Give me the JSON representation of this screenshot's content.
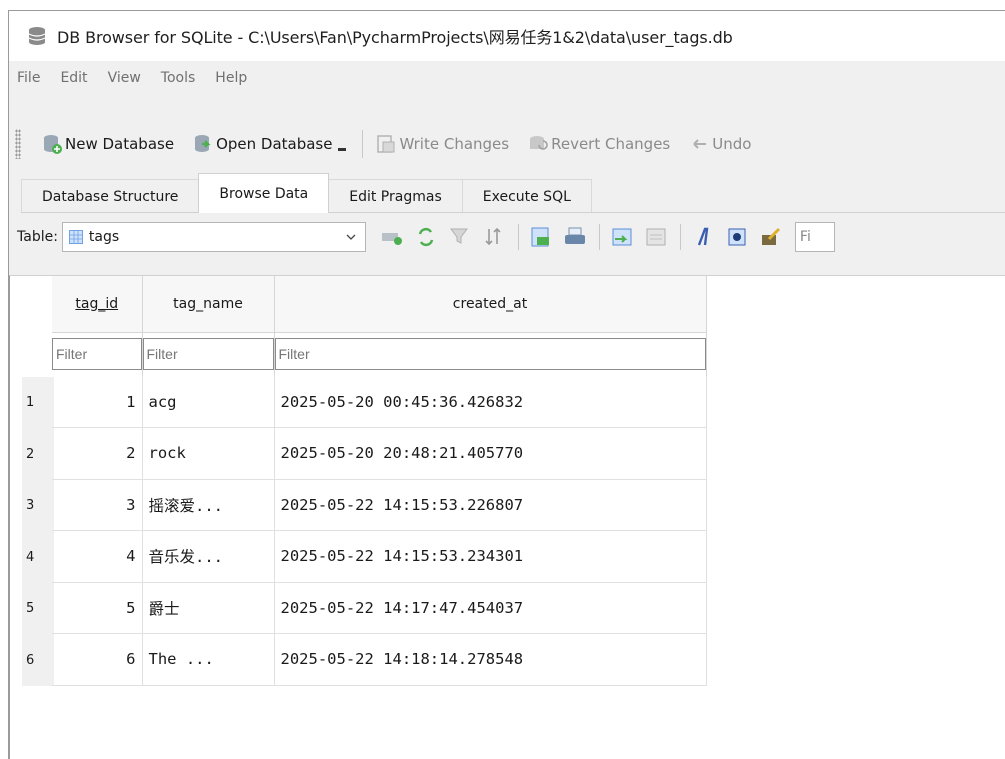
{
  "window": {
    "title": "DB Browser for SQLite - C:\\Users\\Fan\\PycharmProjects\\网易任务1&2\\data\\user_tags.db"
  },
  "menu": [
    "File",
    "Edit",
    "View",
    "Tools",
    "Help"
  ],
  "toolbar": {
    "new_database": "New Database",
    "open_database": "Open Database",
    "write_changes": "Write Changes",
    "revert_changes": "Revert Changes",
    "undo": "Undo"
  },
  "tabs": [
    "Database Structure",
    "Browse Data",
    "Edit Pragmas",
    "Execute SQL"
  ],
  "active_tab": "Browse Data",
  "table_bar": {
    "label": "Table:",
    "selected_table": "tags",
    "find_placeholder": "Fi"
  },
  "grid": {
    "columns": [
      "tag_id",
      "tag_name",
      "created_at"
    ],
    "filter_placeholder": "Filter",
    "rows": [
      {
        "row": "1",
        "tag_id": "1",
        "tag_name": "acg",
        "created_at": "2025-05-20 00:45:36.426832"
      },
      {
        "row": "2",
        "tag_id": "2",
        "tag_name": "rock",
        "created_at": "2025-05-20 20:48:21.405770"
      },
      {
        "row": "3",
        "tag_id": "3",
        "tag_name": "摇滚爱...",
        "created_at": "2025-05-22 14:15:53.226807"
      },
      {
        "row": "4",
        "tag_id": "4",
        "tag_name": "音乐发...",
        "created_at": "2025-05-22 14:15:53.234301"
      },
      {
        "row": "5",
        "tag_id": "5",
        "tag_name": "爵士",
        "created_at": "2025-05-22 14:17:47.454037"
      },
      {
        "row": "6",
        "tag_id": "6",
        "tag_name": "The ...",
        "created_at": "2025-05-22 14:18:14.278548"
      }
    ]
  },
  "colors": {
    "accent_green": "#4caf50",
    "accent_blue": "#3b7dd8",
    "window_bg": "#f0f0f0"
  }
}
